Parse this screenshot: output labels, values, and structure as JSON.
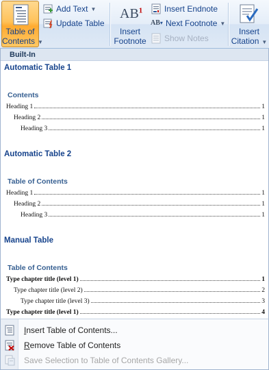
{
  "ribbon": {
    "toc_button": {
      "line1": "Table of",
      "line2": "Contents"
    },
    "add_text": "Add Text",
    "update_table": "Update Table",
    "insert_footnote": {
      "line1": "Insert",
      "line2": "Footnote"
    },
    "insert_endnote": "Insert Endnote",
    "next_footnote": "Next Footnote",
    "show_notes": "Show Notes",
    "insert_citation": {
      "line1": "Insert",
      "line2": "Citation"
    },
    "footnote_icon_text": "AB",
    "footnote_icon_sup": "1",
    "next_footnote_icon_text": "AB"
  },
  "gallery": {
    "header": "Built-In",
    "sections": [
      {
        "title": "Automatic Table 1",
        "preview_title": "Contents",
        "entries": [
          {
            "text": "Heading 1",
            "page": "1",
            "level": 1,
            "bold": false
          },
          {
            "text": "Heading 2",
            "page": "1",
            "level": 2,
            "bold": false
          },
          {
            "text": "Heading 3",
            "page": "1",
            "level": 3,
            "bold": false
          }
        ]
      },
      {
        "title": "Automatic Table 2",
        "preview_title": "Table of Contents",
        "entries": [
          {
            "text": "Heading 1",
            "page": "1",
            "level": 1,
            "bold": false
          },
          {
            "text": "Heading 2",
            "page": "1",
            "level": 2,
            "bold": false
          },
          {
            "text": "Heading 3",
            "page": "1",
            "level": 3,
            "bold": false
          }
        ]
      },
      {
        "title": "Manual Table",
        "preview_title": "Table of Contents",
        "entries": [
          {
            "text": "Type chapter title (level 1)",
            "page": "1",
            "level": 1,
            "bold": true
          },
          {
            "text": "Type chapter title (level 2)",
            "page": "2",
            "level": 2,
            "bold": false
          },
          {
            "text": "Type chapter title (level 3)",
            "page": "3",
            "level": 3,
            "bold": false
          },
          {
            "text": "Type chapter title (level 1)",
            "page": "4",
            "level": 1,
            "bold": true
          }
        ]
      }
    ]
  },
  "menu": {
    "insert_toc": {
      "accel": "I",
      "rest": "nsert Table of Contents..."
    },
    "remove_toc": {
      "accel": "R",
      "rest": "emove Table of Contents"
    },
    "save_selection": {
      "label": "Save Selection to Table of Contents Gallery..."
    }
  },
  "colors": {
    "accent_orange": "#ffc25a",
    "ribbon_text": "#15428b",
    "preview_heading": "#365f91",
    "footnote_sup": "#c00000"
  }
}
